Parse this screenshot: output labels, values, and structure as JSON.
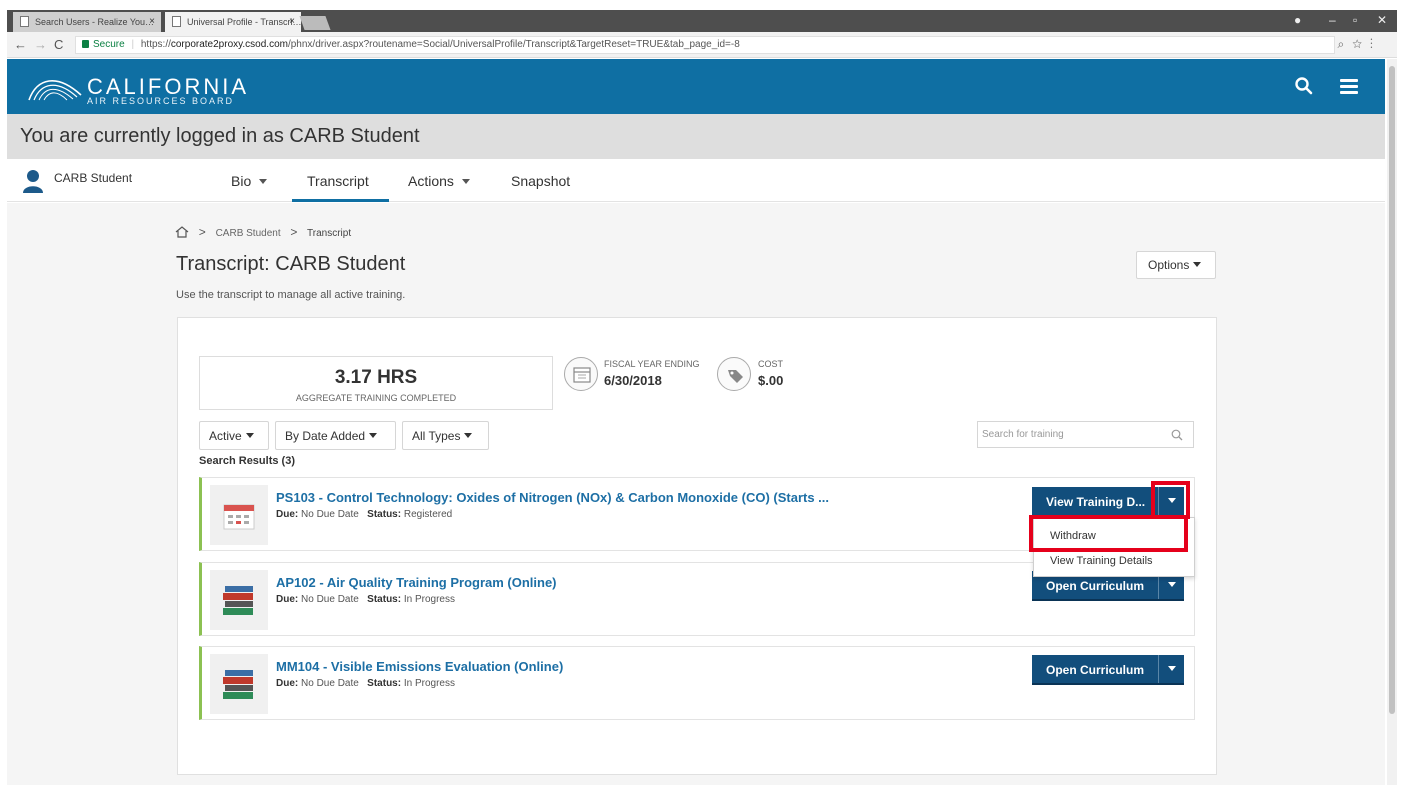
{
  "browser": {
    "tabs": [
      {
        "title": "Search Users - Realize You…",
        "active": false
      },
      {
        "title": "Universal Profile - Transcri…",
        "active": true
      }
    ],
    "secure_label": "Secure",
    "url_scheme": "https://",
    "url_host": "corporate2proxy.csod.com",
    "url_path": "/phnx/driver.aspx?routename=Social/UniversalProfile/Transcript&TargetReset=TRUE&tab_page_id=-8"
  },
  "header": {
    "logo_main": "CALIFORNIA",
    "logo_sub": "AIR RESOURCES BOARD",
    "brand_color": "#0f6fa3"
  },
  "proxy_banner": "You are currently logged in as CARB Student",
  "user": {
    "name": "CARB Student"
  },
  "nav": {
    "bio": "Bio",
    "transcript": "Transcript",
    "actions": "Actions",
    "snapshot": "Snapshot",
    "active_tab": "Transcript"
  },
  "breadcrumb": {
    "user": "CARB Student",
    "page": "Transcript"
  },
  "page": {
    "title": "Transcript: CARB Student",
    "description": "Use the transcript to manage all active training.",
    "options_label": "Options"
  },
  "stats": {
    "hours_value": "3.17 HRS",
    "hours_label": "AGGREGATE TRAINING COMPLETED",
    "fiscal_label": "FISCAL YEAR ENDING",
    "fiscal_value": "6/30/2018",
    "cost_label": "COST",
    "cost_value": "$.00"
  },
  "filters": {
    "status": "Active",
    "sort": "By Date Added",
    "types": "All Types",
    "search_placeholder": "Search for training"
  },
  "results_label": "Search Results (3)",
  "labels": {
    "due": "Due:",
    "status": "Status:"
  },
  "items": [
    {
      "title": "PS103 - Control Technology: Oxides of Nitrogen (NOx) & Carbon Monoxide (CO) (Starts ...",
      "due": "No Due Date",
      "status": "Registered",
      "action": "View Training D..."
    },
    {
      "title": "AP102 - Air Quality Training Program (Online)",
      "due": "No Due Date",
      "status": "In Progress",
      "action": "Open Curriculum"
    },
    {
      "title": "MM104 - Visible Emissions Evaluation (Online)",
      "due": "No Due Date",
      "status": "In Progress",
      "action": "Open Curriculum"
    }
  ],
  "dropdown": {
    "items": [
      "Withdraw",
      "View Training Details"
    ]
  },
  "highlight_color": "#e5001b"
}
